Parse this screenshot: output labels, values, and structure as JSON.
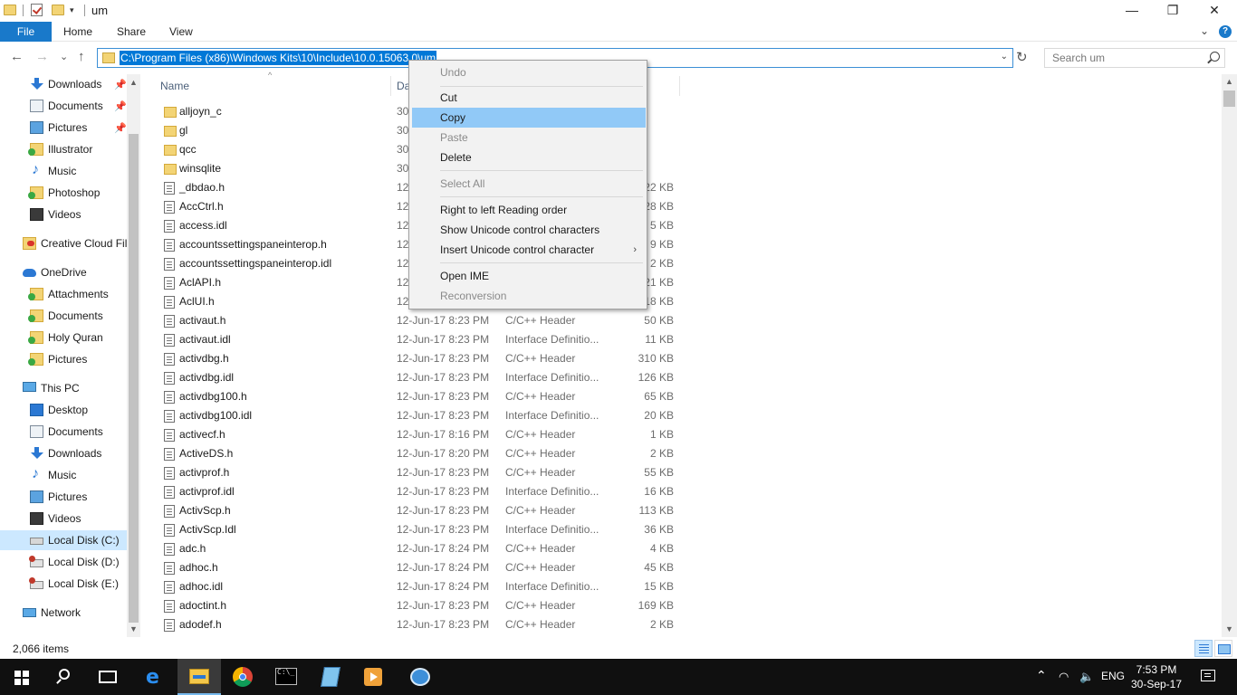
{
  "window": {
    "title": "um",
    "minimize": "—",
    "maximize": "❐",
    "close": "✕"
  },
  "ribbon": {
    "tabs": [
      "File",
      "Home",
      "Share",
      "View"
    ],
    "collapse": "⌄",
    "help": "?"
  },
  "address": {
    "path": "C:\\Program Files (x86)\\Windows Kits\\10\\Include\\10.0.15063.0\\um",
    "dropdown": "⌄",
    "refresh": "↻",
    "back": "←",
    "forward": "→",
    "recent": "⌄",
    "up": "↑"
  },
  "search": {
    "placeholder": "Search um"
  },
  "nav": {
    "items": [
      {
        "label": "Downloads",
        "icon": "downloads-icon",
        "pinned": true
      },
      {
        "label": "Documents",
        "icon": "documents-icon",
        "pinned": true
      },
      {
        "label": "Pictures",
        "icon": "pictures-icon",
        "pinned": true
      },
      {
        "label": "Illustrator",
        "icon": "synced-folder-icon"
      },
      {
        "label": "Music",
        "icon": "music-icon"
      },
      {
        "label": "Photoshop",
        "icon": "synced-folder-icon"
      },
      {
        "label": "Videos",
        "icon": "videos-icon"
      },
      {
        "label": "Creative Cloud Fil",
        "icon": "creative-cloud-icon"
      },
      {
        "label": "OneDrive",
        "icon": "onedrive-icon"
      },
      {
        "label": "Attachments",
        "icon": "synced-folder-icon"
      },
      {
        "label": "Documents",
        "icon": "synced-folder-icon"
      },
      {
        "label": "Holy Quran",
        "icon": "synced-folder-icon"
      },
      {
        "label": "Pictures",
        "icon": "synced-folder-icon"
      },
      {
        "label": "This PC",
        "icon": "this-pc-icon"
      },
      {
        "label": "Desktop",
        "icon": "desktop-icon"
      },
      {
        "label": "Documents",
        "icon": "documents-icon"
      },
      {
        "label": "Downloads",
        "icon": "downloads-icon"
      },
      {
        "label": "Music",
        "icon": "music-icon"
      },
      {
        "label": "Pictures",
        "icon": "pictures-icon"
      },
      {
        "label": "Videos",
        "icon": "videos-icon"
      },
      {
        "label": "Local Disk (C:)",
        "icon": "local-disk-icon",
        "selected": true
      },
      {
        "label": "Local Disk (D:)",
        "icon": "local-disk-icon"
      },
      {
        "label": "Local Disk (E:)",
        "icon": "local-disk-icon"
      },
      {
        "label": "Network",
        "icon": "network-icon"
      }
    ],
    "pin_glyph": "📌"
  },
  "columns": {
    "name": "Name",
    "date": "Da",
    "sort_glyph": "^"
  },
  "files": [
    {
      "name": "alljoyn_c",
      "date": "30",
      "type": "",
      "size": "",
      "folder": true
    },
    {
      "name": "gl",
      "date": "30",
      "type": "",
      "size": "",
      "folder": true
    },
    {
      "name": "qcc",
      "date": "30",
      "type": "",
      "size": "",
      "folder": true
    },
    {
      "name": "winsqlite",
      "date": "30",
      "type": "",
      "size": "",
      "folder": true
    },
    {
      "name": "_dbdao.h",
      "date": "12",
      "type": "",
      "size": "22 KB"
    },
    {
      "name": "AccCtrl.h",
      "date": "12",
      "type": "",
      "size": "28 KB"
    },
    {
      "name": "access.idl",
      "date": "12",
      "type": "",
      "size": "5 KB"
    },
    {
      "name": "accountssettingspaneinterop.h",
      "date": "12",
      "type": "",
      "size": "9 KB"
    },
    {
      "name": "accountssettingspaneinterop.idl",
      "date": "12",
      "type": "",
      "size": "2 KB"
    },
    {
      "name": "AclAPI.h",
      "date": "12",
      "type": "",
      "size": "21 KB"
    },
    {
      "name": "AclUI.h",
      "date": "12",
      "type": "",
      "size": "18 KB"
    },
    {
      "name": "activaut.h",
      "date": "12-Jun-17 8:23 PM",
      "type": "C/C++ Header",
      "size": "50 KB"
    },
    {
      "name": "activaut.idl",
      "date": "12-Jun-17 8:23 PM",
      "type": "Interface Definitio...",
      "size": "11 KB"
    },
    {
      "name": "activdbg.h",
      "date": "12-Jun-17 8:23 PM",
      "type": "C/C++ Header",
      "size": "310 KB"
    },
    {
      "name": "activdbg.idl",
      "date": "12-Jun-17 8:23 PM",
      "type": "Interface Definitio...",
      "size": "126 KB"
    },
    {
      "name": "activdbg100.h",
      "date": "12-Jun-17 8:23 PM",
      "type": "C/C++ Header",
      "size": "65 KB"
    },
    {
      "name": "activdbg100.idl",
      "date": "12-Jun-17 8:23 PM",
      "type": "Interface Definitio...",
      "size": "20 KB"
    },
    {
      "name": "activecf.h",
      "date": "12-Jun-17 8:16 PM",
      "type": "C/C++ Header",
      "size": "1 KB"
    },
    {
      "name": "ActiveDS.h",
      "date": "12-Jun-17 8:20 PM",
      "type": "C/C++ Header",
      "size": "2 KB"
    },
    {
      "name": "activprof.h",
      "date": "12-Jun-17 8:23 PM",
      "type": "C/C++ Header",
      "size": "55 KB"
    },
    {
      "name": "activprof.idl",
      "date": "12-Jun-17 8:23 PM",
      "type": "Interface Definitio...",
      "size": "16 KB"
    },
    {
      "name": "ActivScp.h",
      "date": "12-Jun-17 8:23 PM",
      "type": "C/C++ Header",
      "size": "113 KB"
    },
    {
      "name": "ActivScp.Idl",
      "date": "12-Jun-17 8:23 PM",
      "type": "Interface Definitio...",
      "size": "36 KB"
    },
    {
      "name": "adc.h",
      "date": "12-Jun-17 8:24 PM",
      "type": "C/C++ Header",
      "size": "4 KB"
    },
    {
      "name": "adhoc.h",
      "date": "12-Jun-17 8:24 PM",
      "type": "C/C++ Header",
      "size": "45 KB"
    },
    {
      "name": "adhoc.idl",
      "date": "12-Jun-17 8:24 PM",
      "type": "Interface Definitio...",
      "size": "15 KB"
    },
    {
      "name": "adoctint.h",
      "date": "12-Jun-17 8:23 PM",
      "type": "C/C++ Header",
      "size": "169 KB"
    },
    {
      "name": "adodef.h",
      "date": "12-Jun-17 8:23 PM",
      "type": "C/C++ Header",
      "size": "2 KB"
    }
  ],
  "context_menu": {
    "items": [
      {
        "label": "Undo",
        "disabled": true
      },
      {
        "separator": true
      },
      {
        "label": "Cut"
      },
      {
        "label": "Copy",
        "highlighted": true
      },
      {
        "label": "Paste",
        "disabled": true
      },
      {
        "label": "Delete"
      },
      {
        "separator": true
      },
      {
        "label": "Select All",
        "disabled": true
      },
      {
        "separator": true
      },
      {
        "label": "Right to left Reading order"
      },
      {
        "label": "Show Unicode control characters"
      },
      {
        "label": "Insert Unicode control character",
        "submenu": true
      },
      {
        "separator": true
      },
      {
        "label": "Open IME"
      },
      {
        "label": "Reconversion",
        "disabled": true
      }
    ],
    "submenu_glyph": "›"
  },
  "status": {
    "item_count": "2,066 items"
  },
  "taskbar": {
    "apps": [
      "start-icon",
      "search-icon",
      "task-view-icon",
      "edge-icon",
      "file-explorer-icon",
      "chrome-icon",
      "cmd-icon",
      "notepad-icon",
      "media-player-icon",
      "bird-app-icon"
    ],
    "tray_up": "⌃",
    "language": "ENG",
    "time": "7:53 PM",
    "date": "30-Sep-17"
  },
  "colors": {
    "accent": "#0078d7",
    "file_tab": "#1979ca",
    "menu_highlight": "#91c9f7",
    "selected_nav": "#cce8ff",
    "taskbar": "#101010"
  }
}
